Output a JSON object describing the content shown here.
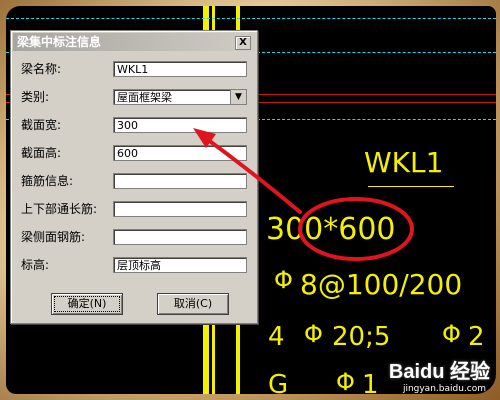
{
  "dialog": {
    "title": "梁集中标注信息",
    "close_label": "X",
    "fields": [
      {
        "label": "梁名称:",
        "value": "WKL1"
      },
      {
        "label": "类别:",
        "value": "屋面框架梁"
      },
      {
        "label": "截面宽:",
        "value": "300"
      },
      {
        "label": "截面高:",
        "value": "600"
      },
      {
        "label": "箍筋信息:",
        "value": ""
      },
      {
        "label": "上下部通长筋:",
        "value": ""
      },
      {
        "label": "梁侧面钢筋:",
        "value": ""
      },
      {
        "label": "标高:",
        "value": "层顶标高"
      }
    ],
    "ok_label": "确定(N)",
    "cancel_label": "取消(C)"
  },
  "drawing": {
    "beam_name": "WKL1",
    "section": "300*600",
    "stirrup": "8@100/200",
    "rebar_line_a": "4",
    "rebar_line_b": "20;5",
    "rebar_line_c": "2",
    "bottom_partial": "G",
    "bottom_partial_b": "1"
  },
  "watermark": {
    "brand": "Baidu 经验",
    "url": "jingyan.baidu.com"
  },
  "colors": {
    "cad_text": "#f4f000",
    "annotation": "#e0141e",
    "canvas": "#000000",
    "dialog_bg": "#d4d0c8"
  }
}
